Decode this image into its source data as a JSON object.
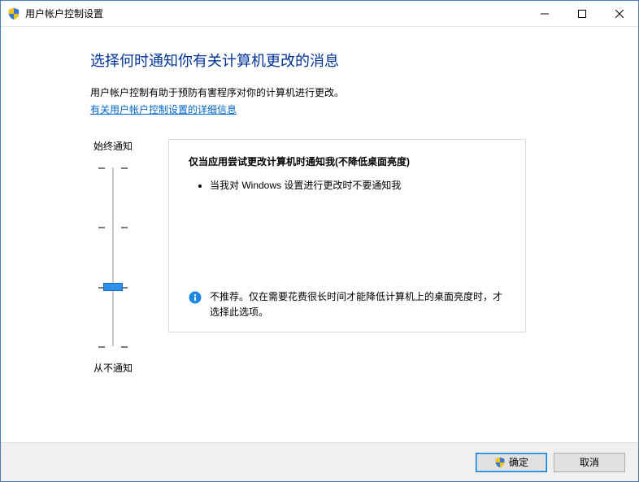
{
  "window": {
    "title": "用户帐户控制设置"
  },
  "main": {
    "heading": "选择何时通知你有关计算机更改的消息",
    "description": "用户帐户控制有助于预防有害程序对你的计算机进行更改。",
    "link": "有关用户帐户控制设置的详细信息"
  },
  "slider": {
    "top_label": "始终通知",
    "bottom_label": "从不通知",
    "level_total": 4,
    "current_level": 2
  },
  "panel": {
    "title": "仅当应用尝试更改计算机时通知我(不降低桌面亮度)",
    "bullet1": "当我对 Windows 设置进行更改时不要通知我",
    "recommendation": "不推荐。仅在需要花费很长时间才能降低计算机上的桌面亮度时，才选择此选项。"
  },
  "buttons": {
    "ok": "确定",
    "cancel": "取消"
  }
}
